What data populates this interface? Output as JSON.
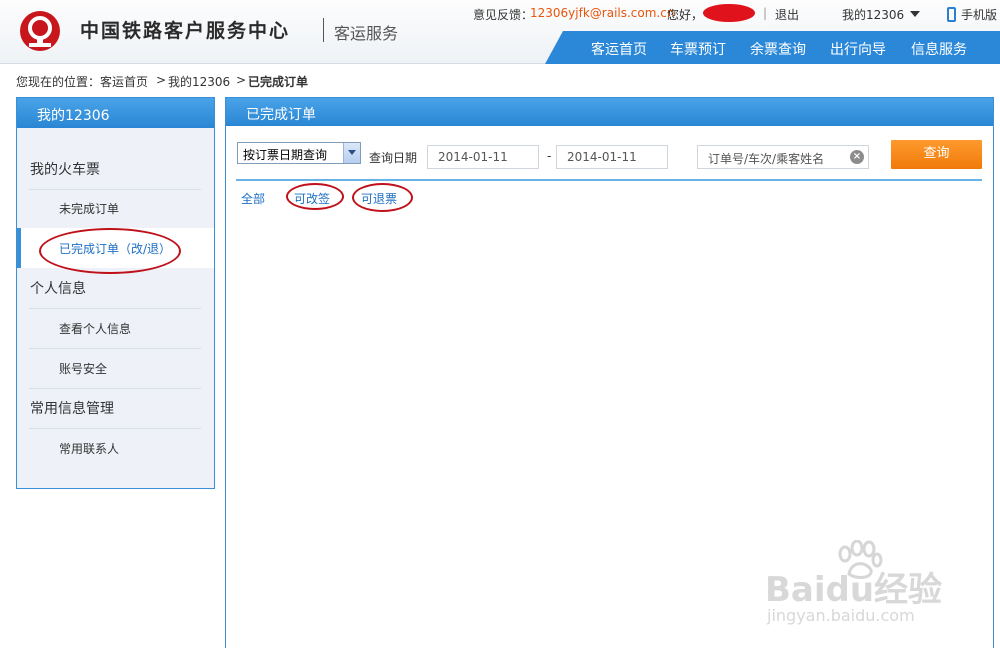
{
  "header": {
    "brand": "中国铁路客户服务中心",
    "sub": "客运服务",
    "feedback_label": "意见反馈：",
    "feedback_email": "12306yjfk@rails.com.cn",
    "hello": "您好，",
    "separator": "|",
    "logout": "退出",
    "my_account": "我的12306",
    "mobile": "手机版",
    "nav": [
      "客运首页",
      "车票预订",
      "余票查询",
      "出行向导",
      "信息服务"
    ],
    "accent_color": "#2b88d8"
  },
  "breadcrumb": {
    "prefix": "您现在的位置：",
    "home": "客运首页",
    "sep1": ">",
    "level2": "我的12306",
    "sep2": ">",
    "current": "已完成订单"
  },
  "sidebar": {
    "title": "我的12306",
    "groups": [
      {
        "label": "我的火车票",
        "items": [
          "未完成订单",
          "已完成订单（改/退）"
        ]
      },
      {
        "label": "个人信息",
        "items": [
          "查看个人信息",
          "账号安全"
        ]
      },
      {
        "label": "常用信息管理",
        "items": [
          "常用联系人"
        ]
      }
    ],
    "active_item": "已完成订单（改/退）"
  },
  "main": {
    "title": "已完成订单",
    "query_type": "按订票日期查询",
    "date_label": "查询日期",
    "date_from": "2014-01-11",
    "date_sep": "-",
    "date_to": "2014-01-11",
    "search_placeholder": "订单号/车次/乘客姓名",
    "query_button": "查询",
    "tabs": [
      "全部",
      "可改签",
      "可退票"
    ]
  },
  "watermark": {
    "brand": "Baidu经验",
    "url": "jingyan.baidu.com"
  }
}
